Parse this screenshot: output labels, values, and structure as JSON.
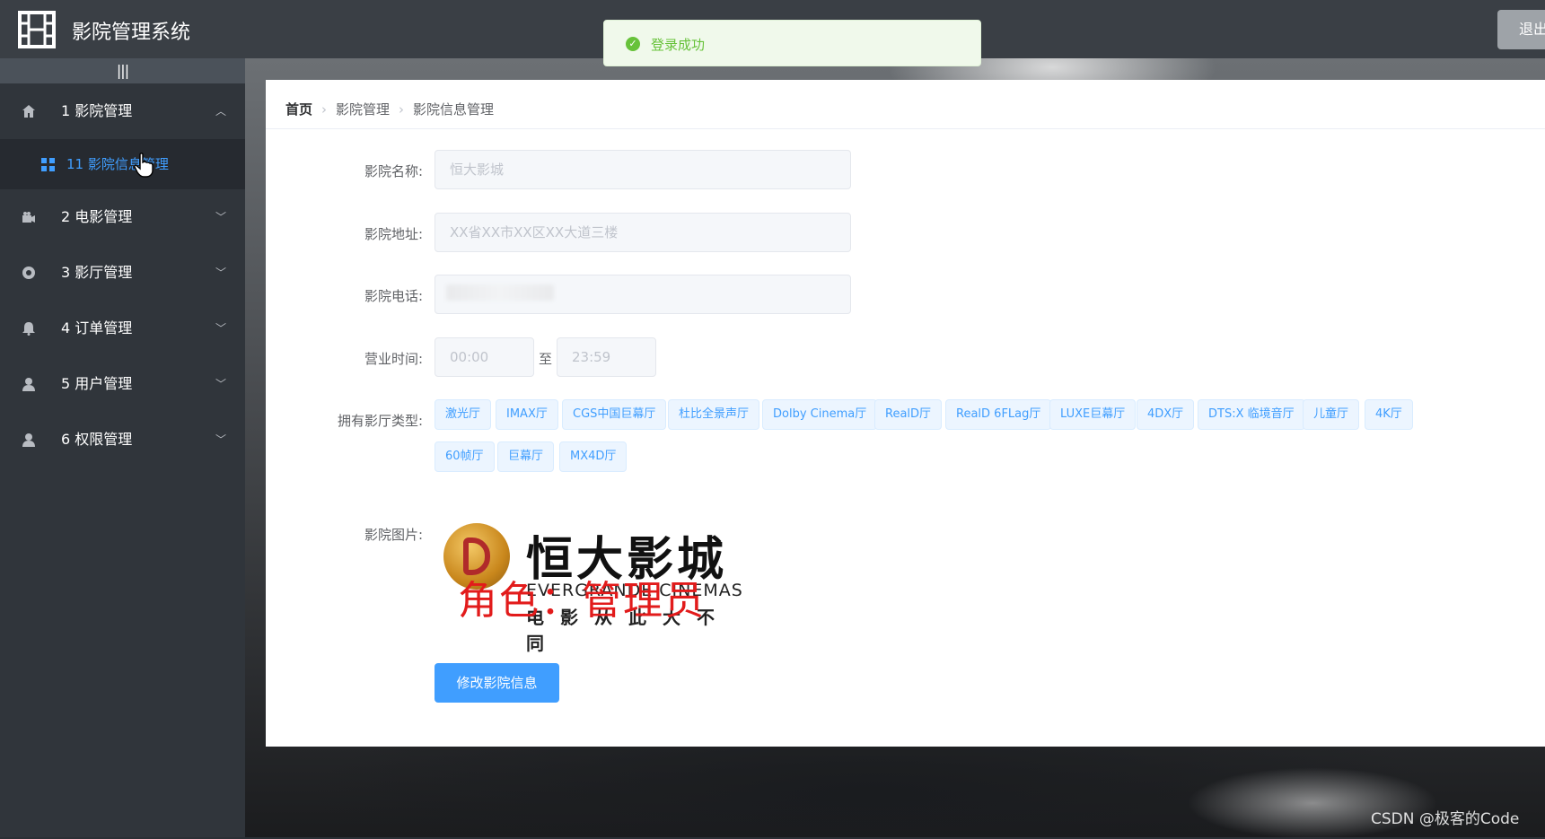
{
  "header": {
    "title": "影院管理系统",
    "logout_label": "退出"
  },
  "toast": {
    "message": "登录成功"
  },
  "sidebar": {
    "collapse_glyph": "|||",
    "items": [
      {
        "label": "1 影院管理",
        "icon": "home-icon",
        "expanded": true
      },
      {
        "label": "2 电影管理",
        "icon": "camera-icon",
        "expanded": false
      },
      {
        "label": "3 影厅管理",
        "icon": "aperture-icon",
        "expanded": false
      },
      {
        "label": "4 订单管理",
        "icon": "bell-icon",
        "expanded": false
      },
      {
        "label": "5 用户管理",
        "icon": "user-icon",
        "expanded": false
      },
      {
        "label": "6 权限管理",
        "icon": "user-icon",
        "expanded": false
      }
    ],
    "sub_item": {
      "label": "11 影院信息管理",
      "icon": "grid-icon",
      "active": true
    }
  },
  "breadcrumb": {
    "home": "首页",
    "level1": "影院管理",
    "level2": "影院信息管理"
  },
  "form": {
    "name_label": "影院名称:",
    "name_value": "恒大影城",
    "address_label": "影院地址:",
    "address_value": "XX省XX市XX区XX大道三楼",
    "phone_label": "影院电话:",
    "hours_label": "营业时间:",
    "open_time": "00:00",
    "to_text": "至",
    "close_time": "23:59",
    "halls_label": "拥有影厅类型:",
    "hall_types": [
      "激光厅",
      "IMAX厅",
      "CGS中国巨幕厅",
      "杜比全景声厅",
      "Dolby Cinema厅",
      "RealD厅",
      "RealD 6FLag厅",
      "LUXE巨幕厅",
      "4DX厅",
      "DTS:X 临境音厅",
      "儿童厅",
      "4K厅",
      "60帧厅",
      "巨幕厅",
      "MX4D厅"
    ],
    "image_label": "影院图片:",
    "submit_label": "修改影院信息"
  },
  "poster": {
    "brand_cn": "恒大影城",
    "brand_en": "EVERGRANDE CINEMAS",
    "slogan": "电影从此大不同",
    "overlay_text": "角色：管理员"
  },
  "watermark": "CSDN @极客的Code",
  "colors": {
    "accent": "#409eff",
    "success": "#67c23a",
    "sidebar": "#30353b",
    "header": "#3a3f45"
  }
}
